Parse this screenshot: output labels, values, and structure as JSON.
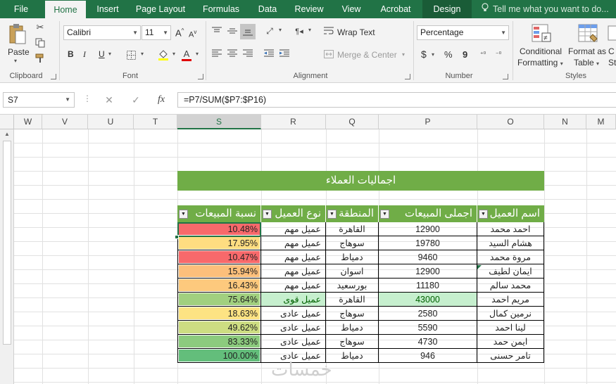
{
  "ribbon_tabs": [
    "File",
    "Home",
    "Insert",
    "Page Layout",
    "Formulas",
    "Data",
    "Review",
    "View",
    "Acrobat",
    "Design"
  ],
  "active_tab": "Home",
  "tell_me": "Tell me what you want to do...",
  "clipboard": {
    "paste_label": "Paste",
    "group_label": "Clipboard"
  },
  "font": {
    "name": "Calibri",
    "size": "11",
    "group_label": "Font",
    "bold": "B",
    "italic": "I",
    "underline": "U",
    "grow": "A",
    "shrink": "A",
    "color_letter": "A"
  },
  "alignment": {
    "wrap_text": "Wrap Text",
    "merge_center": "Merge & Center",
    "group_label": "Alignment"
  },
  "number": {
    "format": "Percentage",
    "currency": "$",
    "percent": "%",
    "comma": "9",
    "group_label": "Number"
  },
  "styles": {
    "conditional_1": "Conditional",
    "conditional_2": "Formatting",
    "format_as_1": "Format as",
    "format_as_2": "Table",
    "cell_styles_1": "C",
    "cell_styles_2": "St",
    "group_label": "Styles"
  },
  "formula_bar": {
    "name_box": "S7",
    "cancel": "✕",
    "enter": "✓",
    "fx": "fx",
    "formula": "=P7/SUM($P7:$P16)"
  },
  "columns": [
    "W",
    "V",
    "U",
    "T",
    "S",
    "R",
    "Q",
    "P",
    "O",
    "N",
    "M"
  ],
  "selected_column": "S",
  "table": {
    "title": "اجماليات العملاء",
    "headers": {
      "pct": "نسبة المبيعات",
      "type": "نوع العميل",
      "region": "المنطقة",
      "total": "اجملى المبيعات",
      "name": "اسم العميل"
    },
    "rows": [
      {
        "pct": "10.48%",
        "type": "عميل مهم",
        "region": "القاهرة",
        "total": "12900",
        "name": "احمد محمد",
        "pct_color": "#f8696b"
      },
      {
        "pct": "17.95%",
        "type": "عميل مهم",
        "region": "سوهاج",
        "total": "19780",
        "name": "هشام السيد",
        "pct_color": "#fedd81"
      },
      {
        "pct": "10.47%",
        "type": "عميل مهم",
        "region": "دمياط",
        "total": "9460",
        "name": "مروة محمد",
        "pct_color": "#f8696b"
      },
      {
        "pct": "15.94%",
        "type": "عميل مهم",
        "region": "اسوان",
        "total": "12900",
        "name": "ايمان لطيف",
        "pct_color": "#fcbf7b"
      },
      {
        "pct": "16.43%",
        "type": "عميل مهم",
        "region": "بورسعيد",
        "total": "11180",
        "name": "محمد سالم",
        "pct_color": "#fdc97d"
      },
      {
        "pct": "75.64%",
        "type": "عميل قوى",
        "region": "القاهرة",
        "total": "43000",
        "name": "مريم احمد",
        "pct_color": "#a1d07f",
        "highlight": "#c6efce",
        "highlight_text": "#006100"
      },
      {
        "pct": "18.63%",
        "type": "عميل عادى",
        "region": "سوهاج",
        "total": "2580",
        "name": "نرمين كمال",
        "pct_color": "#fde383"
      },
      {
        "pct": "49.62%",
        "type": "عميل عادى",
        "region": "دمياط",
        "total": "5590",
        "name": "لينا احمد",
        "pct_color": "#cddd82"
      },
      {
        "pct": "83.33%",
        "type": "عميل عادى",
        "region": "سوهاج",
        "total": "4730",
        "name": "ايمن حمد",
        "pct_color": "#8ccb7e"
      },
      {
        "pct": "100.00%",
        "type": "عميل عادى",
        "region": "دمياط",
        "total": "946",
        "name": "تامر حسنى",
        "pct_color": "#63be7b"
      }
    ]
  },
  "watermark": "خمسات",
  "colors": {
    "excel_green": "#217346",
    "table_green": "#70ad47"
  }
}
